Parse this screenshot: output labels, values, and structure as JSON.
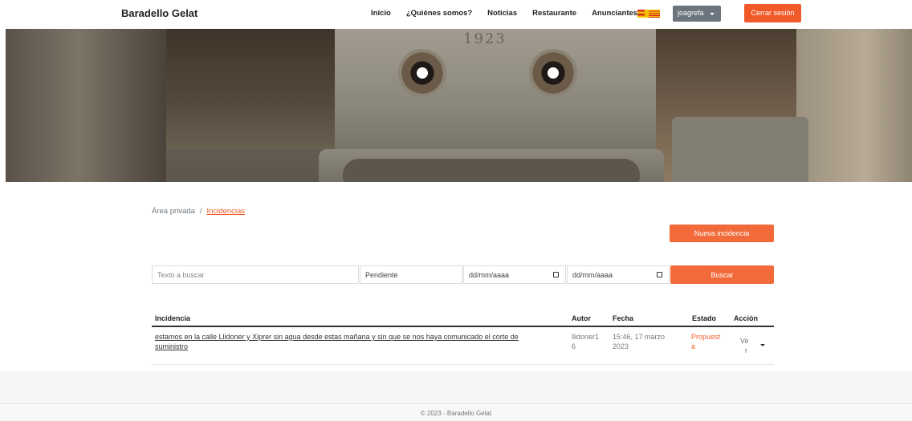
{
  "navbar": {
    "brand": "Baradello Gelat",
    "links": [
      "Inicio",
      "¿Quiénes somos?",
      "Noticias",
      "Restaurante",
      "Anunciantes"
    ],
    "user": "joagrefa",
    "logout": "Cerrar sesión"
  },
  "hero": {
    "engraving": "1923"
  },
  "breadcrumb": {
    "root": "Área privada",
    "separator": "/",
    "current": "Incidencias"
  },
  "actions": {
    "new_incident": "Nueva incidencia"
  },
  "filters": {
    "search_placeholder": "Texto a buscar",
    "status_value": "Pendiente",
    "date_from_placeholder": "dd/mm/aaaa",
    "date_to_placeholder": "dd/mm/aaaa",
    "search_button": "Buscar"
  },
  "table": {
    "headers": [
      "Incidencia",
      "Autor",
      "Fecha",
      "Estado",
      "Acción"
    ],
    "rows": [
      {
        "incidence_line1": "estamos en la calle Llidoner y Xiprer sin agua desde estas mañana y sin que se nos haya comunicado el corte de",
        "incidence_line2": "suministro",
        "author_line1": "llidoner1",
        "author_line2": "6",
        "date_line1": "15:46, 17 marzo",
        "date_line2": "2023",
        "status_line1": "Propuest",
        "status_line2": "a",
        "action_line1": "Ve",
        "action_line2": "r"
      }
    ]
  },
  "footer": {
    "text": "© 2023 - Baradello Gelat"
  },
  "colors": {
    "accent": "#f05a28",
    "user_button": "#6c757d"
  }
}
